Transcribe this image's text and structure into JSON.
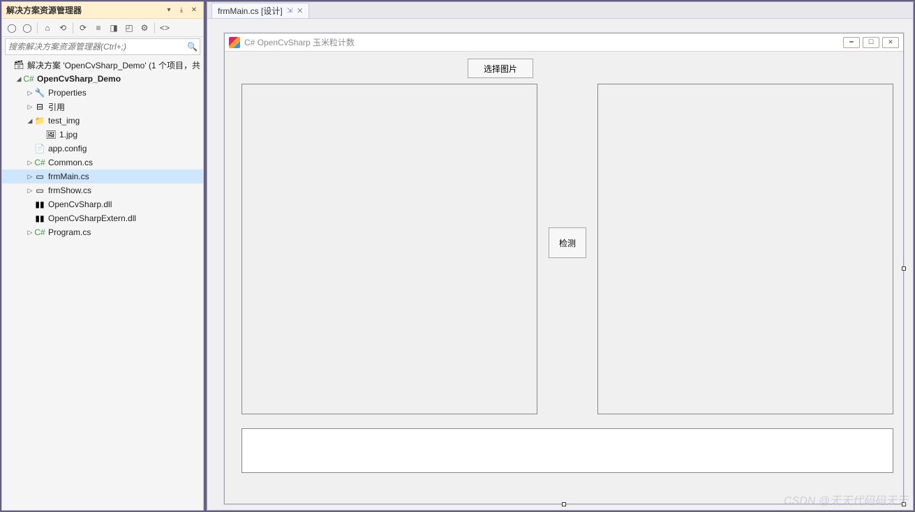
{
  "solutionExplorer": {
    "title": "解决方案资源管理器",
    "searchPlaceholder": "搜索解决方案资源管理器(Ctrl+;)",
    "solutionLabel": "解决方案 'OpenCvSharp_Demo' (1 个项目，共",
    "projectLabel": "OpenCvSharp_Demo",
    "nodes": {
      "properties": "Properties",
      "references": "引用",
      "testImg": "test_img",
      "img1": "1.jpg",
      "appConfig": "app.config",
      "commonCs": "Common.cs",
      "frmMainCs": "frmMain.cs",
      "frmShowCs": "frmShow.cs",
      "opencvDll": "OpenCvSharp.dll",
      "opencvExternDll": "OpenCvSharpExtern.dll",
      "programCs": "Program.cs"
    }
  },
  "tab": {
    "label": "frmMain.cs [设计]"
  },
  "form": {
    "title": "C# OpenCvSharp 玉米粒计数",
    "selectButton": "选择图片",
    "detectButton": "检测"
  },
  "watermark": "CSDN @天天代码码天天"
}
